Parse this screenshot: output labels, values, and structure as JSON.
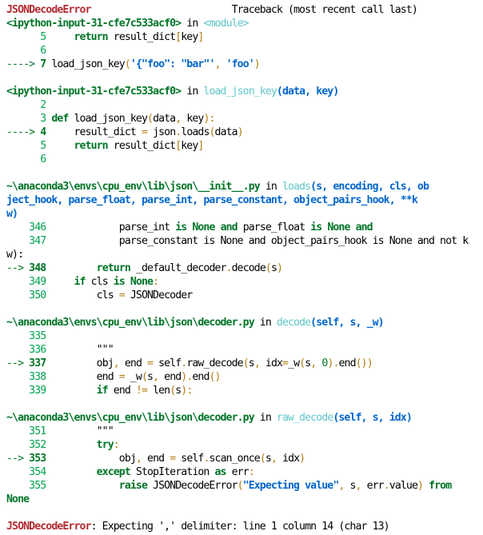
{
  "traceback": {
    "lines": [
      {
        "t": [
          {
            "c": "red",
            "s": "JSONDecodeError"
          },
          {
            "c": "plain",
            "s": "                         Traceback (most recent call last)"
          }
        ]
      },
      {
        "t": [
          {
            "c": "green",
            "s": "<ipython-input-31-cfe7c533acf0>"
          },
          {
            "c": "plain",
            "s": " in "
          },
          {
            "c": "cyan",
            "s": "<module>"
          }
        ]
      },
      {
        "t": [
          {
            "c": "lineno",
            "s": "      5"
          },
          {
            "c": "plain",
            "s": "     "
          },
          {
            "c": "kw",
            "s": "return"
          },
          {
            "c": "plain",
            "s": " result_dict"
          },
          {
            "c": "punct",
            "s": "["
          },
          {
            "c": "plain",
            "s": "key"
          },
          {
            "c": "punct",
            "s": "]"
          }
        ]
      },
      {
        "t": [
          {
            "c": "lineno",
            "s": "      6"
          }
        ]
      },
      {
        "t": [
          {
            "c": "arrow",
            "s": "----> "
          },
          {
            "c": "curno",
            "s": "7"
          },
          {
            "c": "plain",
            "s": " load_json_key"
          },
          {
            "c": "punct",
            "s": "("
          },
          {
            "c": "str",
            "s": "'{\"foo\": \"bar\"'"
          },
          {
            "c": "punct",
            "s": ", "
          },
          {
            "c": "str",
            "s": "'foo'"
          },
          {
            "c": "punct",
            "s": ")"
          }
        ]
      },
      {
        "t": []
      },
      {
        "t": [
          {
            "c": "green",
            "s": "<ipython-input-31-cfe7c533acf0>"
          },
          {
            "c": "plain",
            "s": " in "
          },
          {
            "c": "cyan",
            "s": "load_json_key"
          },
          {
            "c": "blue",
            "s": "(data, key)"
          }
        ]
      },
      {
        "t": [
          {
            "c": "lineno",
            "s": "      2"
          }
        ]
      },
      {
        "t": [
          {
            "c": "lineno",
            "s": "      3 "
          },
          {
            "c": "kw",
            "s": "def"
          },
          {
            "c": "plain",
            "s": " load_json_key"
          },
          {
            "c": "punct",
            "s": "("
          },
          {
            "c": "plain",
            "s": "data"
          },
          {
            "c": "punct",
            "s": ", "
          },
          {
            "c": "plain",
            "s": "key"
          },
          {
            "c": "punct",
            "s": "):"
          }
        ]
      },
      {
        "t": [
          {
            "c": "arrow",
            "s": "----> "
          },
          {
            "c": "curno",
            "s": "4"
          },
          {
            "c": "plain",
            "s": "     result_dict "
          },
          {
            "c": "punct",
            "s": "="
          },
          {
            "c": "plain",
            "s": " json"
          },
          {
            "c": "punct",
            "s": "."
          },
          {
            "c": "plain",
            "s": "loads"
          },
          {
            "c": "punct",
            "s": "("
          },
          {
            "c": "plain",
            "s": "data"
          },
          {
            "c": "punct",
            "s": ")"
          }
        ]
      },
      {
        "t": [
          {
            "c": "lineno",
            "s": "      5"
          },
          {
            "c": "plain",
            "s": "     "
          },
          {
            "c": "kw",
            "s": "return"
          },
          {
            "c": "plain",
            "s": " result_dict"
          },
          {
            "c": "punct",
            "s": "["
          },
          {
            "c": "plain",
            "s": "key"
          },
          {
            "c": "punct",
            "s": "]"
          }
        ]
      },
      {
        "t": [
          {
            "c": "lineno",
            "s": "      6"
          }
        ]
      },
      {
        "t": []
      },
      {
        "t": [
          {
            "c": "green",
            "s": "~\\anaconda3\\envs\\cpu_env\\lib\\json\\__init__.py"
          },
          {
            "c": "plain",
            "s": " in "
          },
          {
            "c": "cyan",
            "s": "loads"
          },
          {
            "c": "blue",
            "s": "(s, encoding, cls, ob"
          }
        ]
      },
      {
        "t": [
          {
            "c": "blue",
            "s": "ject_hook, parse_float, parse_int, parse_constant, object_pairs_hook, **k"
          }
        ]
      },
      {
        "t": [
          {
            "c": "blue",
            "s": "w)"
          }
        ]
      },
      {
        "t": [
          {
            "c": "lineno",
            "s": "    346"
          },
          {
            "c": "plain",
            "s": "             parse_int "
          },
          {
            "c": "kw",
            "s": "is"
          },
          {
            "c": "plain",
            "s": " "
          },
          {
            "c": "kw",
            "s": "None"
          },
          {
            "c": "plain",
            "s": " "
          },
          {
            "c": "kw",
            "s": "and"
          },
          {
            "c": "plain",
            "s": " parse_float "
          },
          {
            "c": "kw",
            "s": "is"
          },
          {
            "c": "plain",
            "s": " "
          },
          {
            "c": "kw",
            "s": "None"
          },
          {
            "c": "plain",
            "s": " "
          },
          {
            "c": "kw",
            "s": "and"
          }
        ]
      },
      {
        "t": [
          {
            "c": "lineno",
            "s": "    347"
          },
          {
            "c": "plain",
            "s": "             parse_constant is None and object_pairs_hook is None and not k"
          }
        ]
      },
      {
        "t": [
          {
            "c": "plain",
            "s": "w):"
          }
        ]
      },
      {
        "t": [
          {
            "c": "arrow",
            "s": "--> "
          },
          {
            "c": "curno",
            "s": "348"
          },
          {
            "c": "plain",
            "s": "         "
          },
          {
            "c": "kw",
            "s": "return"
          },
          {
            "c": "plain",
            "s": " _default_decoder"
          },
          {
            "c": "punct",
            "s": "."
          },
          {
            "c": "plain",
            "s": "decode"
          },
          {
            "c": "punct",
            "s": "("
          },
          {
            "c": "plain",
            "s": "s"
          },
          {
            "c": "punct",
            "s": ")"
          }
        ]
      },
      {
        "t": [
          {
            "c": "lineno",
            "s": "    349"
          },
          {
            "c": "plain",
            "s": "     "
          },
          {
            "c": "kw",
            "s": "if"
          },
          {
            "c": "plain",
            "s": " cls "
          },
          {
            "c": "kw",
            "s": "is"
          },
          {
            "c": "plain",
            "s": " "
          },
          {
            "c": "kw",
            "s": "None"
          },
          {
            "c": "punct",
            "s": ":"
          }
        ]
      },
      {
        "t": [
          {
            "c": "lineno",
            "s": "    350"
          },
          {
            "c": "plain",
            "s": "         cls "
          },
          {
            "c": "punct",
            "s": "="
          },
          {
            "c": "plain",
            "s": " JSONDecoder"
          }
        ]
      },
      {
        "t": []
      },
      {
        "t": [
          {
            "c": "green",
            "s": "~\\anaconda3\\envs\\cpu_env\\lib\\json\\decoder.py"
          },
          {
            "c": "plain",
            "s": " in "
          },
          {
            "c": "cyan",
            "s": "decode"
          },
          {
            "c": "blue",
            "s": "(self, s, _w)"
          }
        ]
      },
      {
        "t": [
          {
            "c": "lineno",
            "s": "    335"
          }
        ]
      },
      {
        "t": [
          {
            "c": "lineno",
            "s": "    336"
          },
          {
            "c": "plain",
            "s": "         \"\"\""
          }
        ]
      },
      {
        "t": [
          {
            "c": "arrow",
            "s": "--> "
          },
          {
            "c": "curno",
            "s": "337"
          },
          {
            "c": "plain",
            "s": "         obj"
          },
          {
            "c": "punct",
            "s": ","
          },
          {
            "c": "plain",
            "s": " end "
          },
          {
            "c": "punct",
            "s": "="
          },
          {
            "c": "plain",
            "s": " self"
          },
          {
            "c": "punct",
            "s": "."
          },
          {
            "c": "plain",
            "s": "raw_decode"
          },
          {
            "c": "punct",
            "s": "("
          },
          {
            "c": "plain",
            "s": "s"
          },
          {
            "c": "punct",
            "s": ","
          },
          {
            "c": "plain",
            "s": " idx"
          },
          {
            "c": "punct",
            "s": "="
          },
          {
            "c": "plain",
            "s": "_w"
          },
          {
            "c": "punct",
            "s": "("
          },
          {
            "c": "plain",
            "s": "s"
          },
          {
            "c": "punct",
            "s": ","
          },
          {
            "c": "plain",
            "s": " "
          },
          {
            "c": "num",
            "s": "0"
          },
          {
            "c": "punct",
            "s": ")."
          },
          {
            "c": "plain",
            "s": "end"
          },
          {
            "c": "punct",
            "s": "())"
          }
        ]
      },
      {
        "t": [
          {
            "c": "lineno",
            "s": "    338"
          },
          {
            "c": "plain",
            "s": "         end "
          },
          {
            "c": "punct",
            "s": "="
          },
          {
            "c": "plain",
            "s": " _w"
          },
          {
            "c": "punct",
            "s": "("
          },
          {
            "c": "plain",
            "s": "s"
          },
          {
            "c": "punct",
            "s": ","
          },
          {
            "c": "plain",
            "s": " end"
          },
          {
            "c": "punct",
            "s": ")."
          },
          {
            "c": "plain",
            "s": "end"
          },
          {
            "c": "punct",
            "s": "()"
          }
        ]
      },
      {
        "t": [
          {
            "c": "lineno",
            "s": "    339"
          },
          {
            "c": "plain",
            "s": "         "
          },
          {
            "c": "kw",
            "s": "if"
          },
          {
            "c": "plain",
            "s": " end "
          },
          {
            "c": "punct",
            "s": "!="
          },
          {
            "c": "plain",
            "s": " len"
          },
          {
            "c": "punct",
            "s": "("
          },
          {
            "c": "plain",
            "s": "s"
          },
          {
            "c": "punct",
            "s": "):"
          }
        ]
      },
      {
        "t": []
      },
      {
        "t": [
          {
            "c": "green",
            "s": "~\\anaconda3\\envs\\cpu_env\\lib\\json\\decoder.py"
          },
          {
            "c": "plain",
            "s": " in "
          },
          {
            "c": "cyan",
            "s": "raw_decode"
          },
          {
            "c": "blue",
            "s": "(self, s, idx)"
          }
        ]
      },
      {
        "t": [
          {
            "c": "lineno",
            "s": "    351"
          },
          {
            "c": "plain",
            "s": "         \"\"\""
          }
        ]
      },
      {
        "t": [
          {
            "c": "lineno",
            "s": "    352"
          },
          {
            "c": "plain",
            "s": "         "
          },
          {
            "c": "kw",
            "s": "try"
          },
          {
            "c": "punct",
            "s": ":"
          }
        ]
      },
      {
        "t": [
          {
            "c": "arrow",
            "s": "--> "
          },
          {
            "c": "curno",
            "s": "353"
          },
          {
            "c": "plain",
            "s": "             obj"
          },
          {
            "c": "punct",
            "s": ","
          },
          {
            "c": "plain",
            "s": " end "
          },
          {
            "c": "punct",
            "s": "="
          },
          {
            "c": "plain",
            "s": " self"
          },
          {
            "c": "punct",
            "s": "."
          },
          {
            "c": "plain",
            "s": "scan_once"
          },
          {
            "c": "punct",
            "s": "("
          },
          {
            "c": "plain",
            "s": "s"
          },
          {
            "c": "punct",
            "s": ","
          },
          {
            "c": "plain",
            "s": " idx"
          },
          {
            "c": "punct",
            "s": ")"
          }
        ]
      },
      {
        "t": [
          {
            "c": "lineno",
            "s": "    354"
          },
          {
            "c": "plain",
            "s": "         "
          },
          {
            "c": "kw",
            "s": "except"
          },
          {
            "c": "plain",
            "s": " StopIteration "
          },
          {
            "c": "kw",
            "s": "as"
          },
          {
            "c": "plain",
            "s": " err"
          },
          {
            "c": "punct",
            "s": ":"
          }
        ]
      },
      {
        "t": [
          {
            "c": "lineno",
            "s": "    355"
          },
          {
            "c": "plain",
            "s": "             "
          },
          {
            "c": "kw",
            "s": "raise"
          },
          {
            "c": "plain",
            "s": " JSONDecodeError"
          },
          {
            "c": "punct",
            "s": "("
          },
          {
            "c": "str",
            "s": "\"Expecting value\""
          },
          {
            "c": "punct",
            "s": ","
          },
          {
            "c": "plain",
            "s": " s"
          },
          {
            "c": "punct",
            "s": ","
          },
          {
            "c": "plain",
            "s": " err"
          },
          {
            "c": "punct",
            "s": "."
          },
          {
            "c": "plain",
            "s": "value"
          },
          {
            "c": "punct",
            "s": ")"
          },
          {
            "c": "plain",
            "s": " "
          },
          {
            "c": "kw",
            "s": "from"
          }
        ]
      },
      {
        "t": [
          {
            "c": "kw",
            "s": "None"
          }
        ]
      },
      {
        "t": []
      },
      {
        "t": [
          {
            "c": "red",
            "s": "JSONDecodeError"
          },
          {
            "c": "plain",
            "s": ": Expecting ',' delimiter: line 1 column 14 (char 13)"
          }
        ]
      }
    ]
  }
}
